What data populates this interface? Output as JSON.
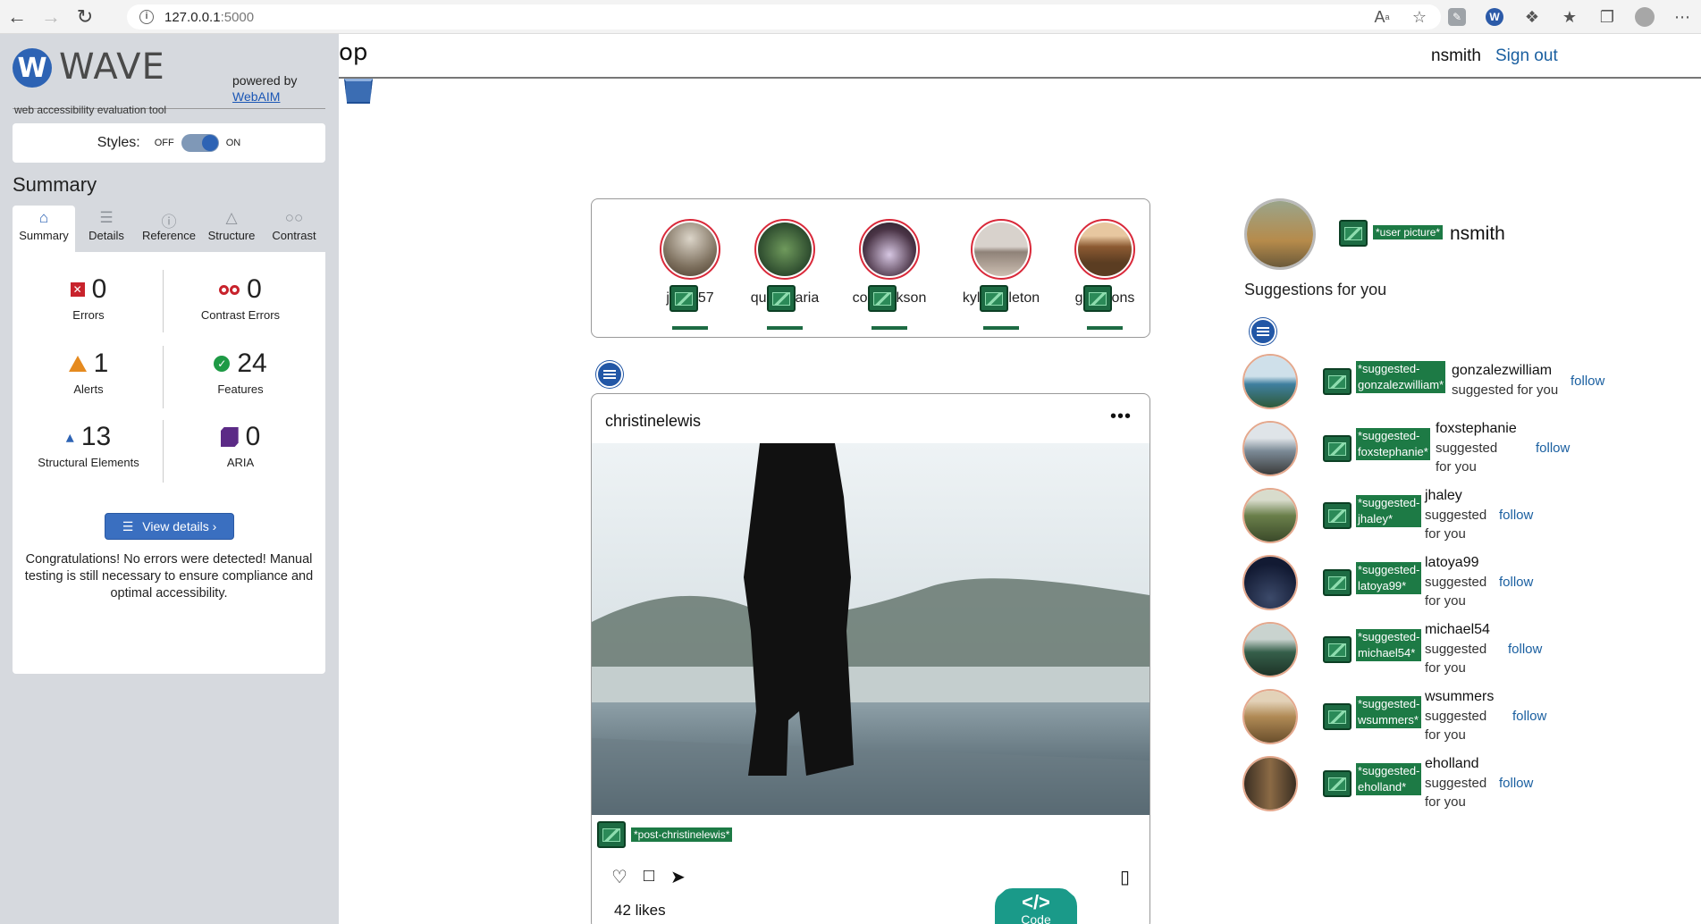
{
  "browser": {
    "url_host": "127.0.0.1",
    "url_port": ":5000"
  },
  "wave": {
    "logo_text": "WAVE",
    "tagline": "web accessibility evaluation tool",
    "powered_by": "powered by",
    "webaim": "WebAIM",
    "styles_label": "Styles:",
    "toggle_off": "OFF",
    "toggle_on": "ON",
    "summary_heading": "Summary",
    "tabs": [
      "Summary",
      "Details",
      "Reference",
      "Structure",
      "Contrast"
    ],
    "stats": {
      "errors": {
        "value": "0",
        "label": "Errors"
      },
      "contrast_errors": {
        "value": "0",
        "label": "Contrast Errors"
      },
      "alerts": {
        "value": "1",
        "label": "Alerts"
      },
      "features": {
        "value": "24",
        "label": "Features"
      },
      "structural": {
        "value": "13",
        "label": "Structural Elements"
      },
      "aria": {
        "value": "0",
        "label": "ARIA"
      }
    },
    "view_details": "View details ›",
    "congrats": "Congratulations! No errors were detected! Manual testing is still necessary to ensure compliance and optimal accessibility."
  },
  "app": {
    "logo_fragment": "op",
    "username": "nsmith",
    "sign_out": "Sign out",
    "stories": [
      {
        "prefix": "j",
        "suffix": "57"
      },
      {
        "prefix": "qu",
        "suffix": "aria"
      },
      {
        "prefix": "co",
        "suffix": "kson"
      },
      {
        "prefix": "kyl",
        "suffix": "leton"
      },
      {
        "prefix": "g",
        "suffix": "ons"
      }
    ],
    "post": {
      "author": "christinelewis",
      "more": "•••",
      "alt": "*post-christinelewis*",
      "likes": "42 likes"
    },
    "code_tab": {
      "symbol": "</>",
      "label": "Code"
    },
    "me": {
      "alt": "*user picture*",
      "name": "nsmith"
    },
    "suggestions_title": "Suggestions for you",
    "suggestions": [
      {
        "alt_1": "*suggested-",
        "alt_2": "gonzalezwilliam*",
        "name": "gonzalezwilliam",
        "note": "suggested for you",
        "follow": "follow"
      },
      {
        "alt_1": "*suggested-",
        "alt_2": "foxstephanie*",
        "name": "foxstephanie",
        "note": "suggested for you",
        "follow": "follow"
      },
      {
        "alt_1": "*suggested-",
        "alt_2": "jhaley*",
        "name": "jhaley",
        "note": "suggested for you",
        "follow": "follow"
      },
      {
        "alt_1": "*suggested-",
        "alt_2": "latoya99*",
        "name": "latoya99",
        "note": "suggested for you",
        "follow": "follow"
      },
      {
        "alt_1": "*suggested-",
        "alt_2": "michael54*",
        "name": "michael54",
        "note": "suggested for you",
        "follow": "follow"
      },
      {
        "alt_1": "*suggested-",
        "alt_2": "wsummers*",
        "name": "wsummers",
        "note": "suggested for you",
        "follow": "follow"
      },
      {
        "alt_1": "*suggested-",
        "alt_2": "eholland*",
        "name": "eholland",
        "note": "suggested for you",
        "follow": "follow"
      }
    ]
  },
  "icons": [
    "back-icon",
    "forward-icon",
    "reload-icon",
    "info-icon",
    "read-aloud-icon",
    "favorite-icon",
    "extension-icon",
    "wave-extension-icon",
    "puzzle-icon",
    "favorites-icon",
    "collections-icon",
    "profile-icon",
    "heart-icon",
    "comment-icon",
    "send-icon",
    "bookmark-icon",
    "list-icon",
    "image-icon"
  ],
  "colors": {
    "wave_blue": "#2d63b4",
    "error_red": "#c8232c",
    "alert_orange": "#e58a1f",
    "feature_green": "#1e9a45",
    "aria_purple": "#5b2a86",
    "link_blue": "#1a5fa0",
    "code_teal": "#1a9a89"
  }
}
